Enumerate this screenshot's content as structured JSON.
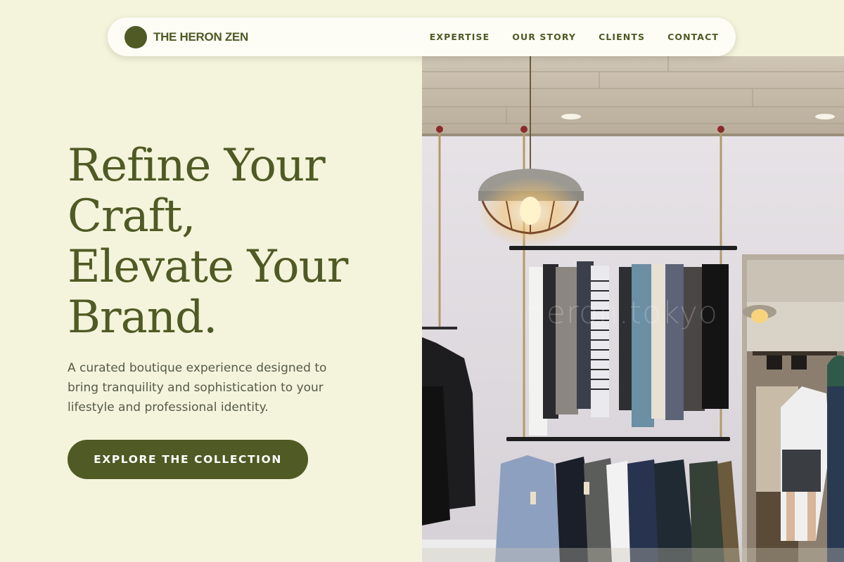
{
  "brand": {
    "name": "THE HERON ZEN",
    "logo_color": "#4f5a24"
  },
  "nav": {
    "links": [
      {
        "label": "EXPERTISE"
      },
      {
        "label": "OUR STORY"
      },
      {
        "label": "CLIENTS"
      },
      {
        "label": "CONTACT"
      }
    ]
  },
  "hero": {
    "title_lines": [
      "Refine Your",
      "Craft,",
      "Elevate Your",
      "Brand."
    ],
    "subtitle": "A curated boutique experience designed to bring tranquility and sophistication to your lifestyle and professional identity.",
    "cta_label": "EXPLORE THE COLLECTION",
    "image_watermark": "heron.tokyo"
  },
  "colors": {
    "background": "#f4f4dc",
    "accent": "#4f5a24",
    "nav_background": "#fdfdf6",
    "body_text": "#555a48"
  }
}
